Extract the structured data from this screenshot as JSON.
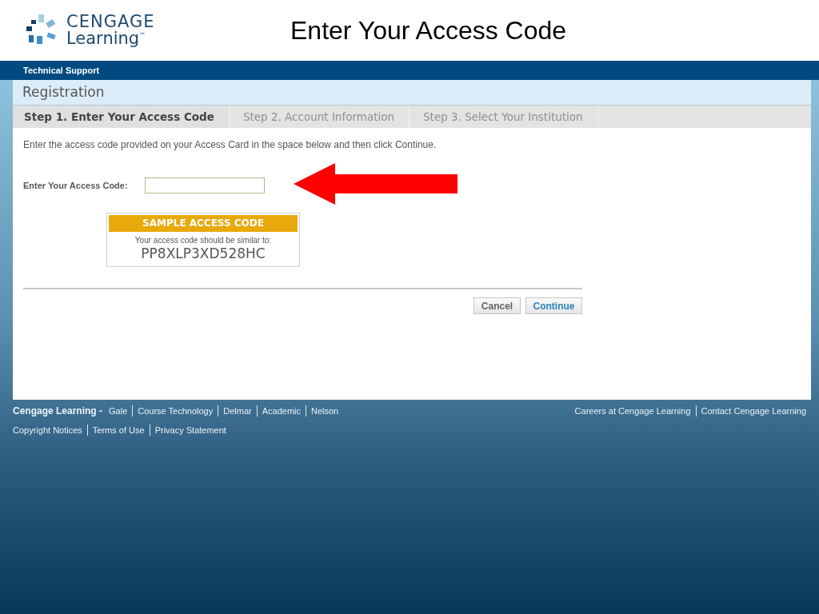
{
  "slide_title": "Enter Your Access Code",
  "logo": {
    "line_1": "CENGAGE",
    "line_2": "Learning$^{™}$"
  },
  "top_bar": {
    "link": "Technical Support"
  },
  "panel": {
    "title": "Registration",
    "steps": [
      {
        "label": "Step 1.  Enter Your Access Code",
        "selected": true
      },
      {
        "label": "Step 2. Account Information",
        "selected": false
      },
      {
        "label": "Step 3. Select Your Institution",
        "selected": false
      }
    ],
    "instructions": "Enter the access code provided on your Access Card in the space below and then click Continue.",
    "field": {
      "label": "Enter Your Access Code:"
    },
    "sample": {
      "heading": "SAMPLE ACCESS CODE",
      "text": "Your access code should be similar to:",
      "code": "PP8XLP3XD528HC"
    },
    "buttons": [
      {
        "label": "Cancel",
        "kind": "secondary"
      },
      {
        "label": "Continue",
        "kind": "primary"
      }
    ]
  },
  "footer": {
    "brand": "Cengage Learning -",
    "brand_links": [
      "Gale",
      "Course Technology",
      "Delmar",
      "Academic",
      "Nelson"
    ],
    "right_links": [
      "Careers at Cengage Learning",
      "Contact Cengage Learning"
    ],
    "legal_links": [
      "Copyright Notices",
      "Terms of Use",
      "Privacy Statement"
    ]
  }
}
